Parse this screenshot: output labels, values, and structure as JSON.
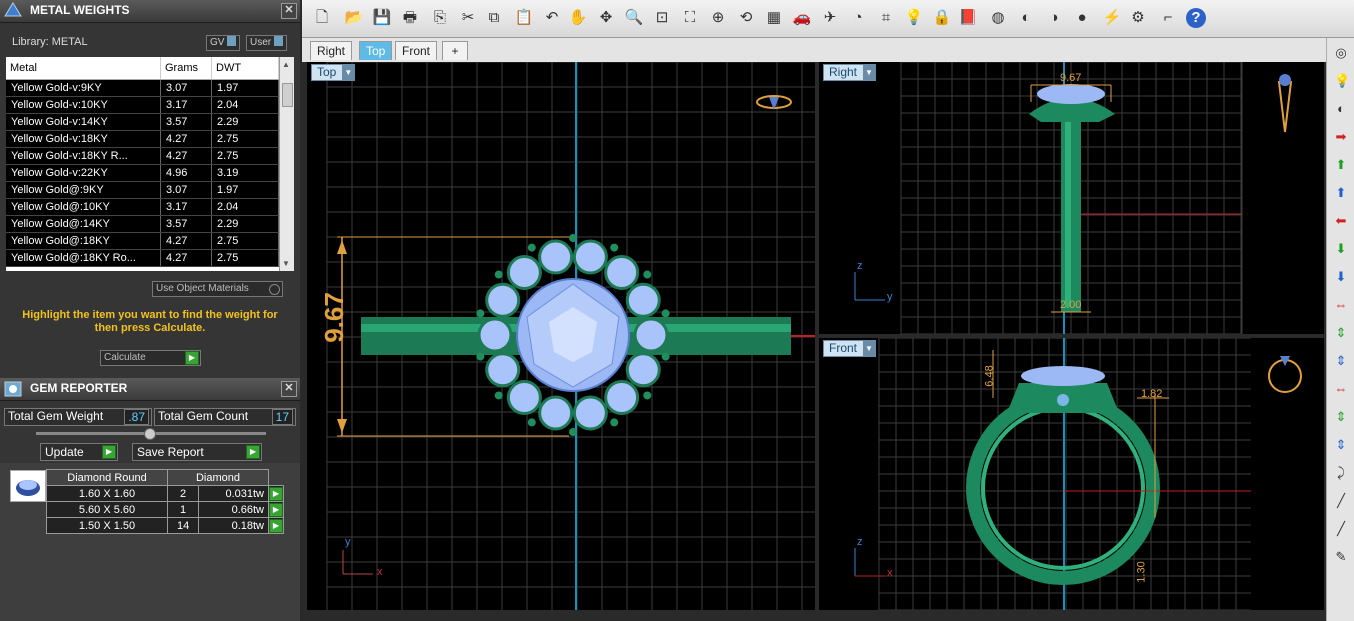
{
  "metal_panel": {
    "title": "METAL WEIGHTS",
    "library_label": "Library: METAL",
    "gv_label": "GV",
    "user_label": "User",
    "columns": [
      "Metal",
      "Grams",
      "DWT"
    ],
    "rows": [
      [
        "Yellow Gold-v:9KY",
        "3.07",
        "1.97"
      ],
      [
        "Yellow Gold-v:10KY",
        "3.17",
        "2.04"
      ],
      [
        "Yellow Gold-v:14KY",
        "3.57",
        "2.29"
      ],
      [
        "Yellow Gold-v:18KY",
        "4.27",
        "2.75"
      ],
      [
        "Yellow Gold-v:18KY R...",
        "4.27",
        "2.75"
      ],
      [
        "Yellow Gold-v:22KY",
        "4.96",
        "3.19"
      ],
      [
        "Yellow Gold@:9KY",
        "3.07",
        "1.97"
      ],
      [
        "Yellow Gold@:10KY",
        "3.17",
        "2.04"
      ],
      [
        "Yellow Gold@:14KY",
        "3.57",
        "2.29"
      ],
      [
        "Yellow Gold@:18KY",
        "4.27",
        "2.75"
      ],
      [
        "Yellow Gold@:18KY Ro...",
        "4.27",
        "2.75"
      ]
    ],
    "use_object_materials": "Use Object Materials",
    "message": "Highlight the item you want to find the weight for then press Calculate.",
    "calculate_label": "Calculate"
  },
  "gem_panel": {
    "title": "GEM REPORTER",
    "total_weight_label": "Total Gem Weight",
    "total_weight_value": ".87",
    "total_count_label": "Total Gem Count",
    "total_count_value": "17",
    "update_label": "Update",
    "save_report_label": "Save Report",
    "table_headers": [
      "Diamond Round",
      "Diamond"
    ],
    "rows": [
      [
        "1.60 X 1.60",
        "2",
        "0.031tw"
      ],
      [
        "5.60 X 5.60",
        "1",
        "0.66tw"
      ],
      [
        "1.50 X 1.50",
        "14",
        "0.18tw"
      ]
    ]
  },
  "tabs": [
    "Right",
    "Top",
    "Front"
  ],
  "active_tab": "Top",
  "add_tab": "+",
  "viewports": {
    "top": {
      "label": "Top",
      "dimension": "9.67",
      "axis_y": "y",
      "axis_x": "x"
    },
    "right": {
      "label": "Right",
      "dim_top": "9.67",
      "dim_bottom": "2.00",
      "axis_z": "z",
      "axis_y": "y"
    },
    "front": {
      "label": "Front",
      "dim_left": "6.48",
      "dim_right": "1.82",
      "dim_bottom": "1.30",
      "axis_z": "z",
      "axis_x": "x"
    }
  },
  "colors": {
    "metal": "#1f8f5e",
    "gem": "#8fb4f0",
    "dimension": "#e0a040",
    "accent_tab": "#5fbbe6"
  }
}
